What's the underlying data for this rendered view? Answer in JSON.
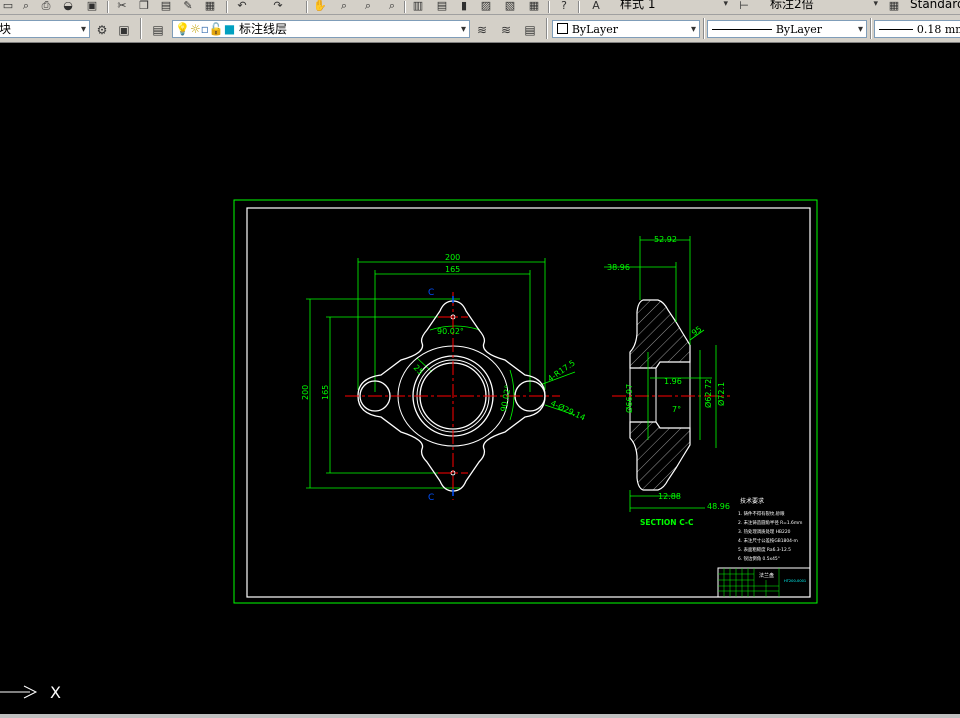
{
  "toolbar_top": {
    "text_style_value": "样式 1",
    "dim_style_value": "标注2倍",
    "table_style_value": "Standard"
  },
  "toolbar_layers": {
    "workspace_value": "块",
    "layer_value": "标注线层",
    "color_value": "ByLayer",
    "linetype_value": "ByLayer",
    "lineweight_value": "0.18 mm"
  },
  "drawing": {
    "dims": {
      "d200_top": "200",
      "d165": "165",
      "d200_left": "200",
      "d165_left": "165",
      "ang1": "90.02°",
      "ang2": "90.02°",
      "d25": "25",
      "r17": "4-R17.5",
      "d29": "4-Ø29.14",
      "s52": "52.92",
      "s38": "38.96",
      "s66": "Ø66.97",
      "s196": "1.96",
      "s62": "Ø62.72",
      "s721": "Ø72.1",
      "s7": "7°",
      "s95": "95",
      "s1288": "12.88",
      "s4896": "48.96"
    },
    "section_marker": "C",
    "section_label": "SECTION C-C",
    "tech_title": "技术要求",
    "notes": [
      "1. 铸件不得有裂纹,砂眼",
      "2. 未注铸造圆角半径 R=1.6mm",
      "3. 热处理调质处理 HB220",
      "4. 未注尺寸公差按GB1804-m",
      "5. 表面粗糙度 Ra6.3-12.5",
      "6. 锐边倒角 0.5x45°"
    ],
    "titleblock_name": "法兰盘",
    "titleblock_code": "HT200-0001"
  },
  "colors": {
    "cad_background": "#000000",
    "geometry": "#ffffff",
    "dimension": "#00ff00",
    "centerline": "#ff0000",
    "border": "#00ff00",
    "hatch": "#ffffff"
  },
  "cursor_axis": "X"
}
